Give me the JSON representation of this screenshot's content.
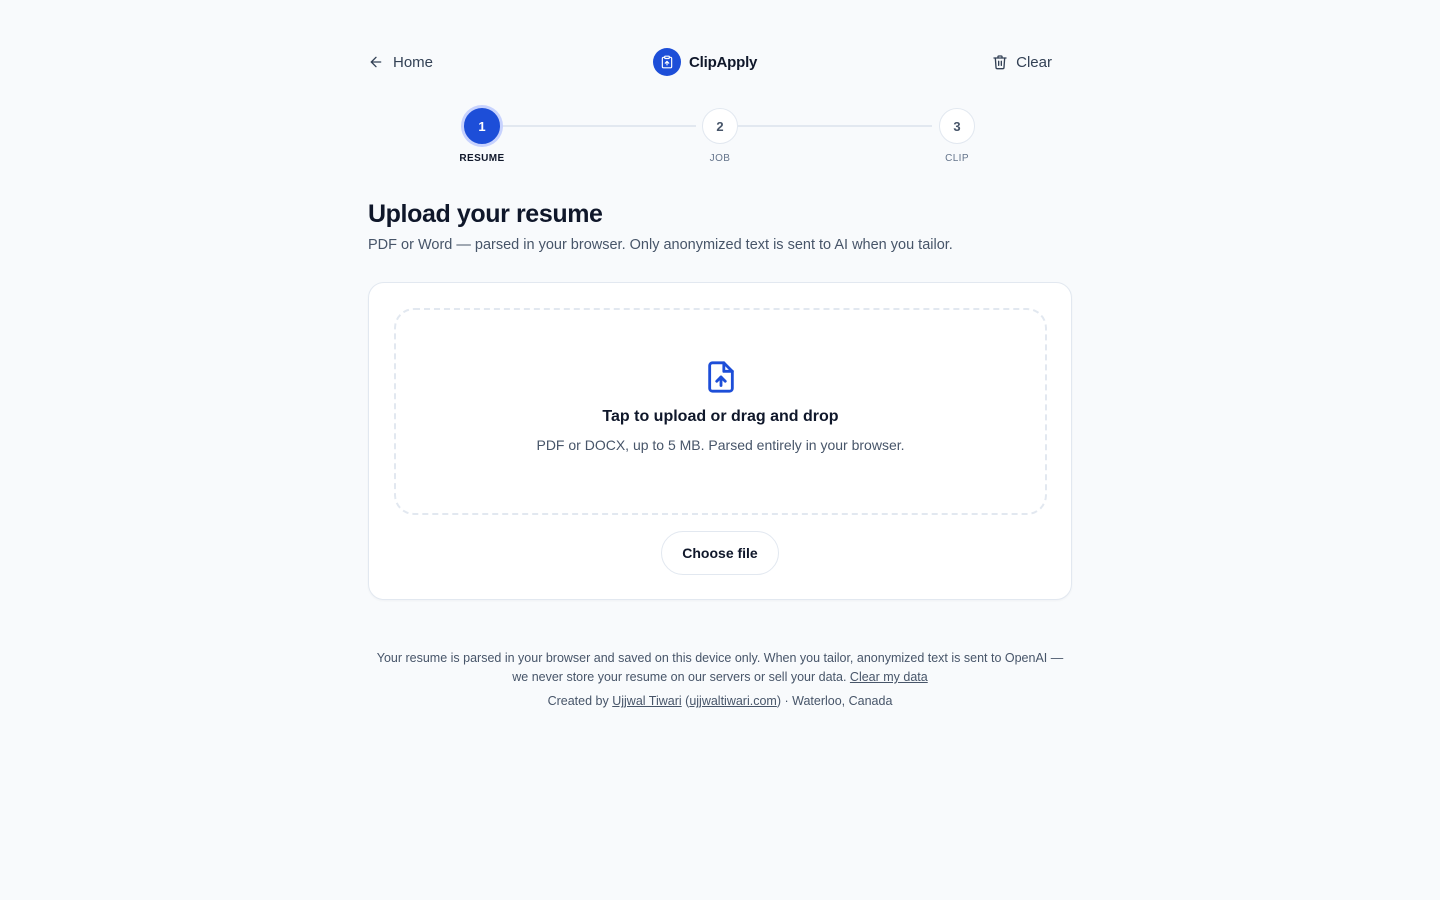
{
  "header": {
    "home_label": "Home",
    "brand_name": "ClipApply",
    "clear_label": "Clear"
  },
  "stepper": {
    "steps": [
      {
        "number": "1",
        "label": "RESUME",
        "active": true
      },
      {
        "number": "2",
        "label": "JOB",
        "active": false
      },
      {
        "number": "3",
        "label": "CLIP",
        "active": false
      }
    ]
  },
  "main": {
    "title": "Upload your resume",
    "subtitle": "PDF or Word — parsed in your browser. Only anonymized text is sent to AI when you tailor."
  },
  "upload": {
    "dropzone_title": "Tap to upload or drag and drop",
    "dropzone_subtitle": "PDF or DOCX, up to 5 MB. Parsed entirely in your browser.",
    "choose_button": "Choose file"
  },
  "footer": {
    "privacy_text": "Your resume is parsed in your browser and saved on this device only. When you tailor, anonymized text is sent to OpenAI — we never store your resume on our servers or sell your data.",
    "clear_link": "Clear my data",
    "created_by": "Created by",
    "author_name": "Ujjwal Tiwari",
    "author_site": "ujjwaltiwari.com",
    "location": "· Waterloo, Canada"
  },
  "colors": {
    "accent": "#1d4ed8",
    "background": "#f8fafc",
    "border": "#e2e8f0",
    "text": "#0f172a",
    "muted": "#475569"
  },
  "icons": {
    "home": "arrow-left-icon",
    "brand": "clipboard-icon",
    "clear": "trash-icon",
    "upload": "file-upload-icon"
  }
}
